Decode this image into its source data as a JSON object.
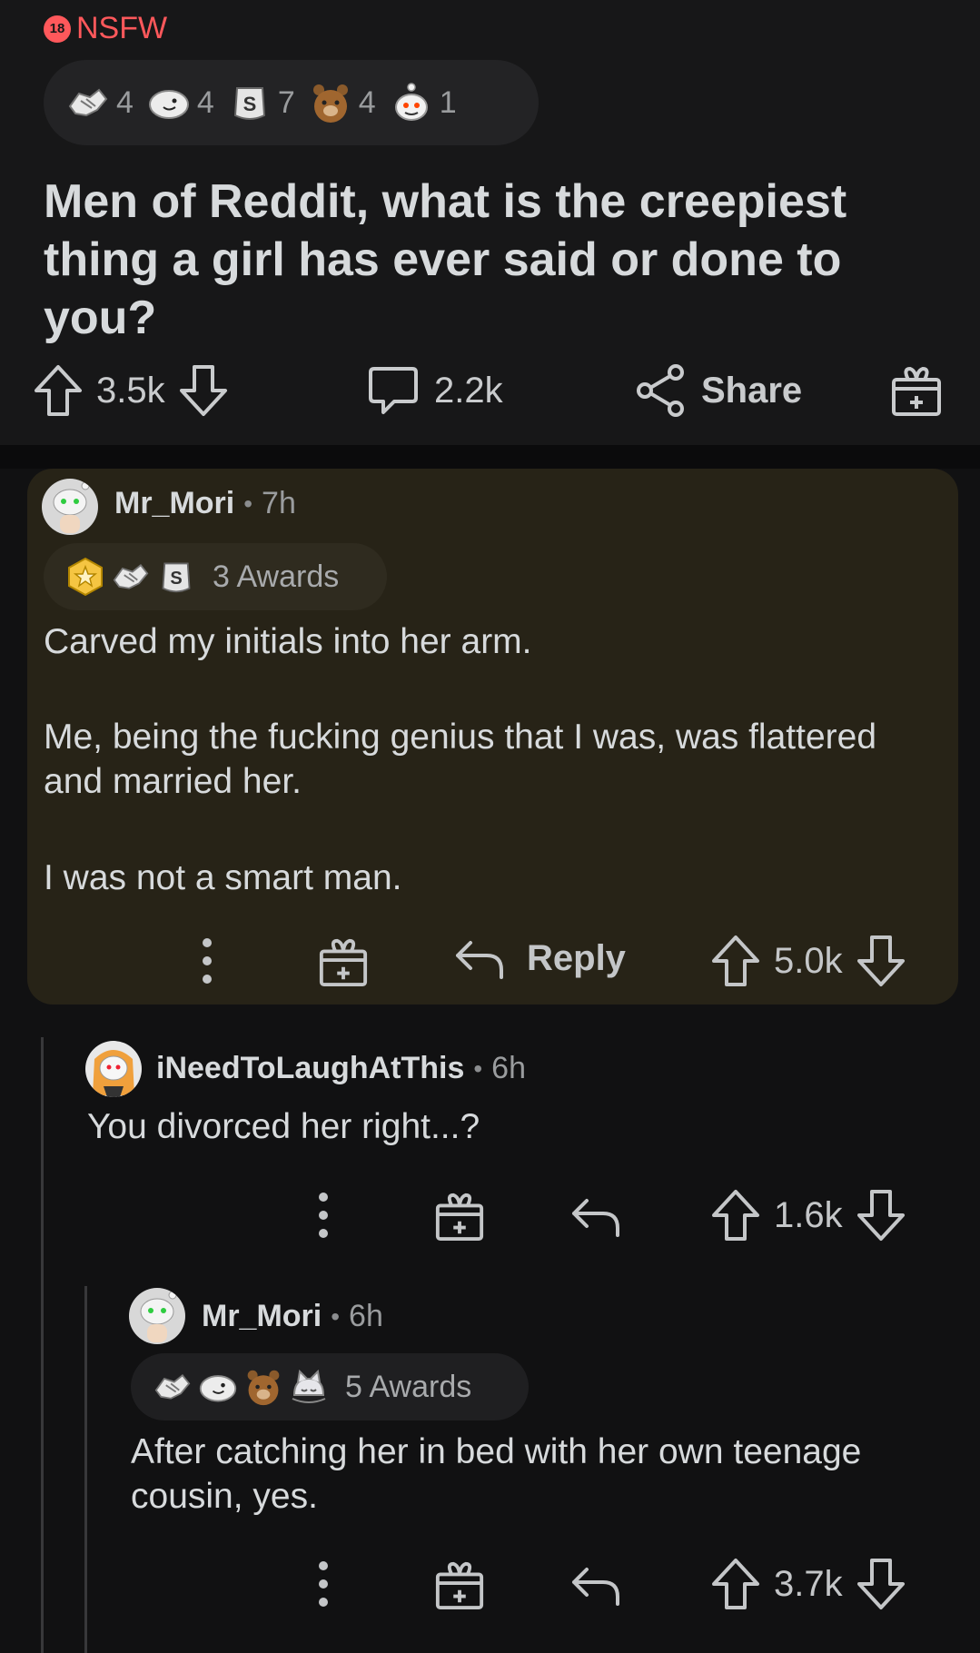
{
  "post": {
    "nsfw_badge": "18",
    "nsfw_label": "NSFW",
    "awards": [
      {
        "icon": "handshake-award-icon",
        "count": "4"
      },
      {
        "icon": "wholesome-seal-award-icon",
        "count": "4"
      },
      {
        "icon": "silver-award-icon",
        "count": "7"
      },
      {
        "icon": "bear-award-icon",
        "count": "4"
      },
      {
        "icon": "snoo-wave-award-icon",
        "count": "1"
      }
    ],
    "title": "Men of Reddit, what is the creepiest thing a girl has ever said or done to you?",
    "upvotes": "3.5k",
    "comments": "2.2k",
    "share_label": "Share"
  },
  "comments": [
    {
      "author": "Mr_Mori",
      "separator": "•",
      "time": "7h",
      "awards_label": "3 Awards",
      "paragraphs": [
        "Carved my initials into her arm.",
        "Me, being the fucking genius that I was, was flattered and married her.",
        "I was not a smart man."
      ],
      "reply_label": "Reply",
      "score": "5.0k"
    },
    {
      "author": "iNeedToLaughAtThis",
      "separator": "•",
      "time": "6h",
      "text": "You divorced her right...?",
      "score": "1.6k"
    },
    {
      "author": "Mr_Mori",
      "separator": "•",
      "time": "6h",
      "awards_label": "5 Awards",
      "text": "After catching her in bed with her own teenage cousin, yes.",
      "score": "3.7k"
    }
  ],
  "colors": {
    "background": "#111112",
    "post_bg": "#171718",
    "highlight_comment_bg": "#272317",
    "nsfw": "#ff585b",
    "text": "#d7dadc"
  }
}
